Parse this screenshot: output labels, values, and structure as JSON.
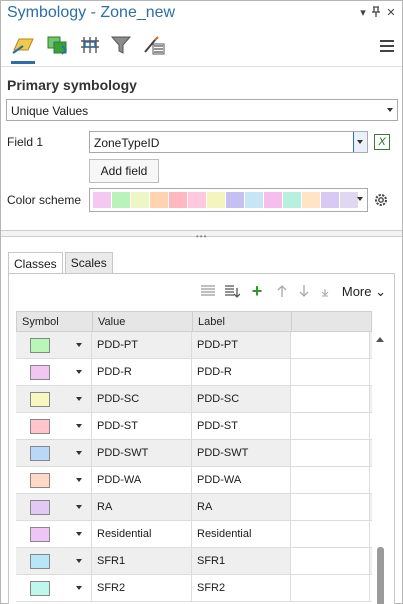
{
  "window": {
    "title": "Symbology - Zone_new",
    "controls": [
      "▾",
      "⊥",
      "✕"
    ]
  },
  "toolbar": {
    "icons": [
      "primary-symbology-icon",
      "vary-symbology-icon",
      "symbol-layers-icon",
      "filter-icon",
      "label-tools-icon"
    ],
    "accent_color": "#2b6ea8"
  },
  "primary": {
    "heading": "Primary symbology",
    "method": "Unique Values"
  },
  "field1": {
    "label": "Field 1",
    "value": "ZoneTypeID",
    "expression_button": "X"
  },
  "add_field": {
    "label": "Add field"
  },
  "color_scheme": {
    "label": "Color scheme",
    "colors": [
      "#f4c8f0",
      "#b9f3b9",
      "#ecf7c5",
      "#ffd2b0",
      "#ffb8c0",
      "#ffc8df",
      "#f4f4bd",
      "#c6c0f2",
      "#c6e6f6",
      "#f7bdef",
      "#b8f0e0",
      "#ffe5c6",
      "#d8c8f4",
      "#e0d8f0"
    ]
  },
  "tabs": [
    {
      "label": "Classes",
      "active": true
    },
    {
      "label": "Scales",
      "active": false
    }
  ],
  "grid_toolbar": {
    "more_label": "More ⌄"
  },
  "table": {
    "columns": [
      "Symbol",
      "Value",
      "Label",
      ""
    ],
    "rows": [
      {
        "color": "#b8f7b8",
        "value": "PDD-PT",
        "label": "PDD-PT"
      },
      {
        "color": "#f2c6f2",
        "value": "PDD-R",
        "label": "PDD-R"
      },
      {
        "color": "#f7f7c0",
        "value": "PDD-SC",
        "label": "PDD-SC"
      },
      {
        "color": "#ffc4cc",
        "value": "PDD-ST",
        "label": "PDD-ST"
      },
      {
        "color": "#b9d8f7",
        "value": "PDD-SWT",
        "label": "PDD-SWT"
      },
      {
        "color": "#fed9c6",
        "value": "PDD-WA",
        "label": "PDD-WA"
      },
      {
        "color": "#e2c8f5",
        "value": "RA",
        "label": "RA"
      },
      {
        "color": "#eec5f6",
        "value": "Residential",
        "label": "Residential"
      },
      {
        "color": "#b6e6f7",
        "value": "SFR1",
        "label": "SFR1"
      },
      {
        "color": "#bff7ee",
        "value": "SFR2",
        "label": "SFR2"
      }
    ]
  }
}
